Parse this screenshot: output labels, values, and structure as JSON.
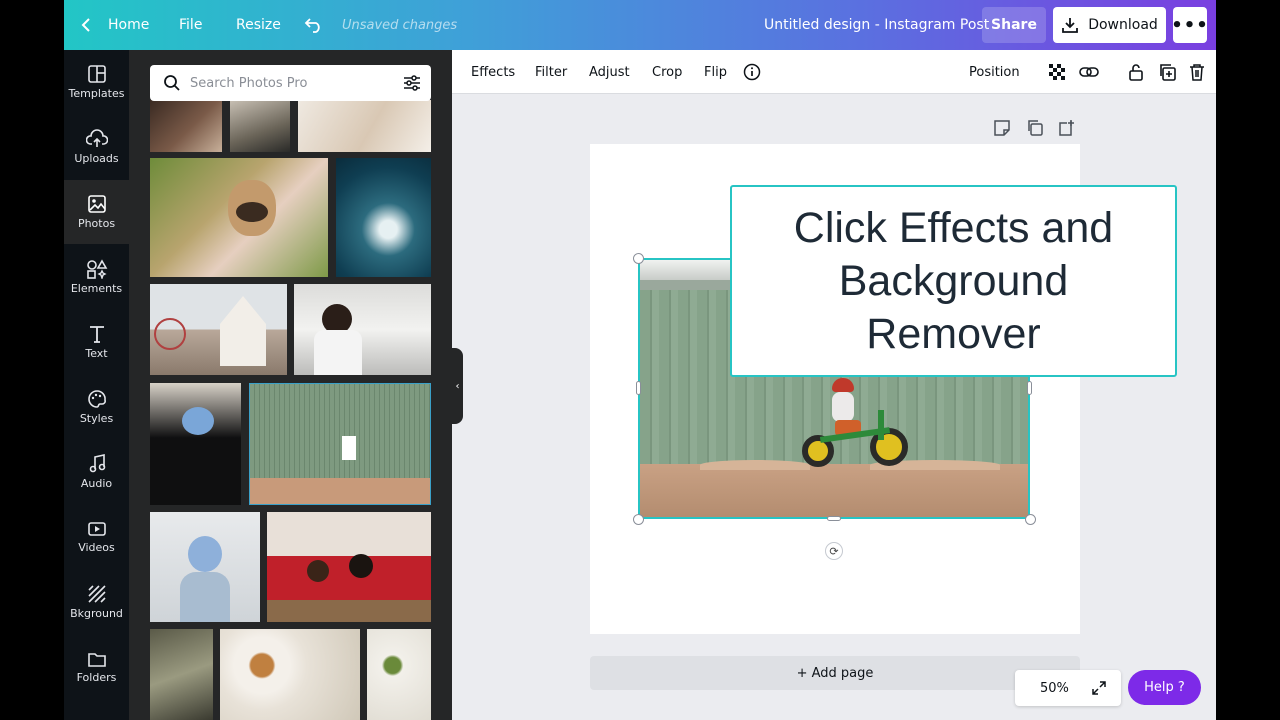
{
  "topbar": {
    "home": "Home",
    "file": "File",
    "resize": "Resize",
    "status": "Unsaved changes",
    "doc_title": "Untitled design - Instagram Post",
    "share": "Share",
    "download": "Download",
    "more": "•••",
    "gradient_start": "#22C6C6",
    "gradient_end": "#7A3FE0"
  },
  "rail": {
    "items": [
      {
        "label": "Templates",
        "icon": "templates-icon"
      },
      {
        "label": "Uploads",
        "icon": "upload-cloud-icon"
      },
      {
        "label": "Photos",
        "icon": "photo-icon",
        "active": true
      },
      {
        "label": "Elements",
        "icon": "shapes-icon"
      },
      {
        "label": "Text",
        "icon": "text-icon"
      },
      {
        "label": "Styles",
        "icon": "palette-icon"
      },
      {
        "label": "Audio",
        "icon": "music-note-icon"
      },
      {
        "label": "Videos",
        "icon": "play-icon"
      },
      {
        "label": "Bkground",
        "icon": "background-pattern-icon"
      },
      {
        "label": "Folders",
        "icon": "folder-icon"
      }
    ]
  },
  "search": {
    "placeholder": "Search Photos Pro"
  },
  "toolbar": {
    "effects": "Effects",
    "filter": "Filter",
    "adjust": "Adjust",
    "crop": "Crop",
    "flip": "Flip",
    "position": "Position"
  },
  "callout": {
    "text": "Click Effects and Background Remover"
  },
  "canvas": {
    "add_page": "+ Add page"
  },
  "zoom": {
    "level": "50%"
  },
  "help": {
    "label": "Help ?"
  },
  "colors": {
    "accent": "#27C4C4",
    "help": "#7D2AE8",
    "panel": "#252627",
    "rail": "#0E1318"
  }
}
